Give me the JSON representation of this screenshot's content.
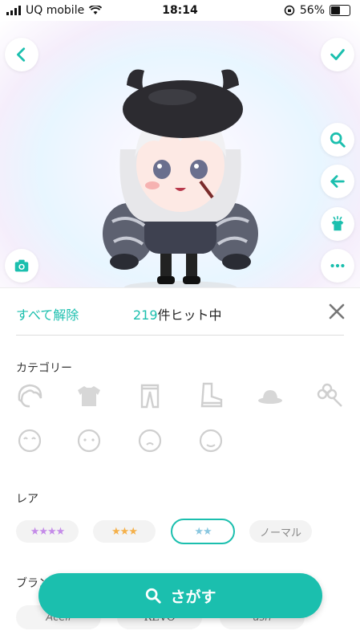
{
  "status_bar": {
    "carrier": "UQ mobile",
    "time": "18:14",
    "battery": "56%",
    "battery_level": 0.56
  },
  "colors": {
    "accent": "#1bbfae",
    "icon_gray": "#cfcfcf"
  },
  "header": {
    "back_icon": "chevron-left-icon",
    "confirm_icon": "check-icon"
  },
  "side_tools": [
    "search-icon",
    "arrow-left-icon",
    "shirt-sparkle-icon",
    "more-icon"
  ],
  "filter": {
    "clear_all": "すべて解除",
    "hit_count": "219",
    "hit_suffix": "件ヒット中"
  },
  "category": {
    "label": "カテゴリー",
    "icons_row1": [
      "hair-icon",
      "top-icon",
      "bottom-icon",
      "shoes-icon",
      "hat-icon",
      "accessory-icon"
    ],
    "icons_row2": [
      "face-smile-icon",
      "face-plain-icon",
      "face-neutral-icon",
      "face-blank-icon"
    ]
  },
  "rarity": {
    "label": "レア",
    "options": [
      {
        "stars": "★★★★",
        "color": "#c48be8"
      },
      {
        "stars": "★★★",
        "color": "#f4b04a"
      },
      {
        "stars": "★★",
        "color": "#8ac7e0",
        "selected": true
      },
      {
        "text": "ノーマル"
      }
    ]
  },
  "brand": {
    "label": "ブラン",
    "items": [
      "Acell",
      "REVO",
      "ash"
    ]
  },
  "search_button": {
    "label": "さがす"
  }
}
